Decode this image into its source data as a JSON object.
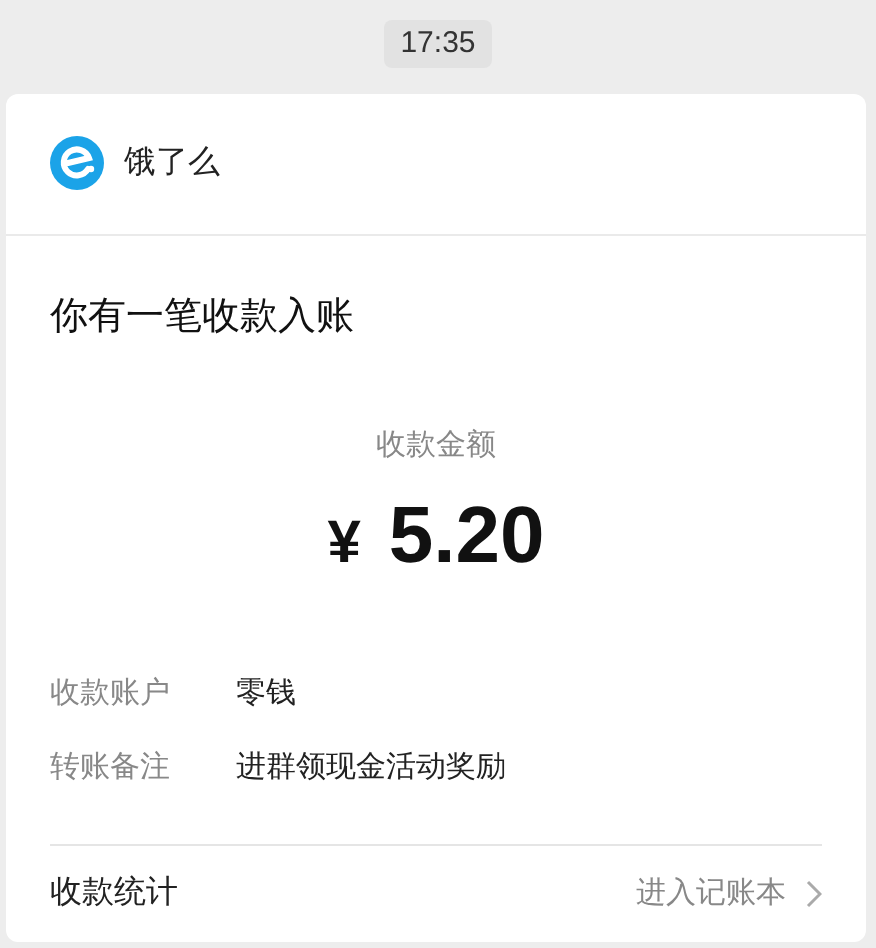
{
  "time": "17:35",
  "merchant": {
    "name": "饿了么"
  },
  "title": "你有一笔收款入账",
  "amount": {
    "label": "收款金额",
    "currency": "¥",
    "value": "5.20"
  },
  "details": [
    {
      "label": "收款账户",
      "value": "零钱"
    },
    {
      "label": "转账备注",
      "value": "进群领现金活动奖励"
    }
  ],
  "footer": {
    "label": "收款统计",
    "link": "进入记账本"
  }
}
